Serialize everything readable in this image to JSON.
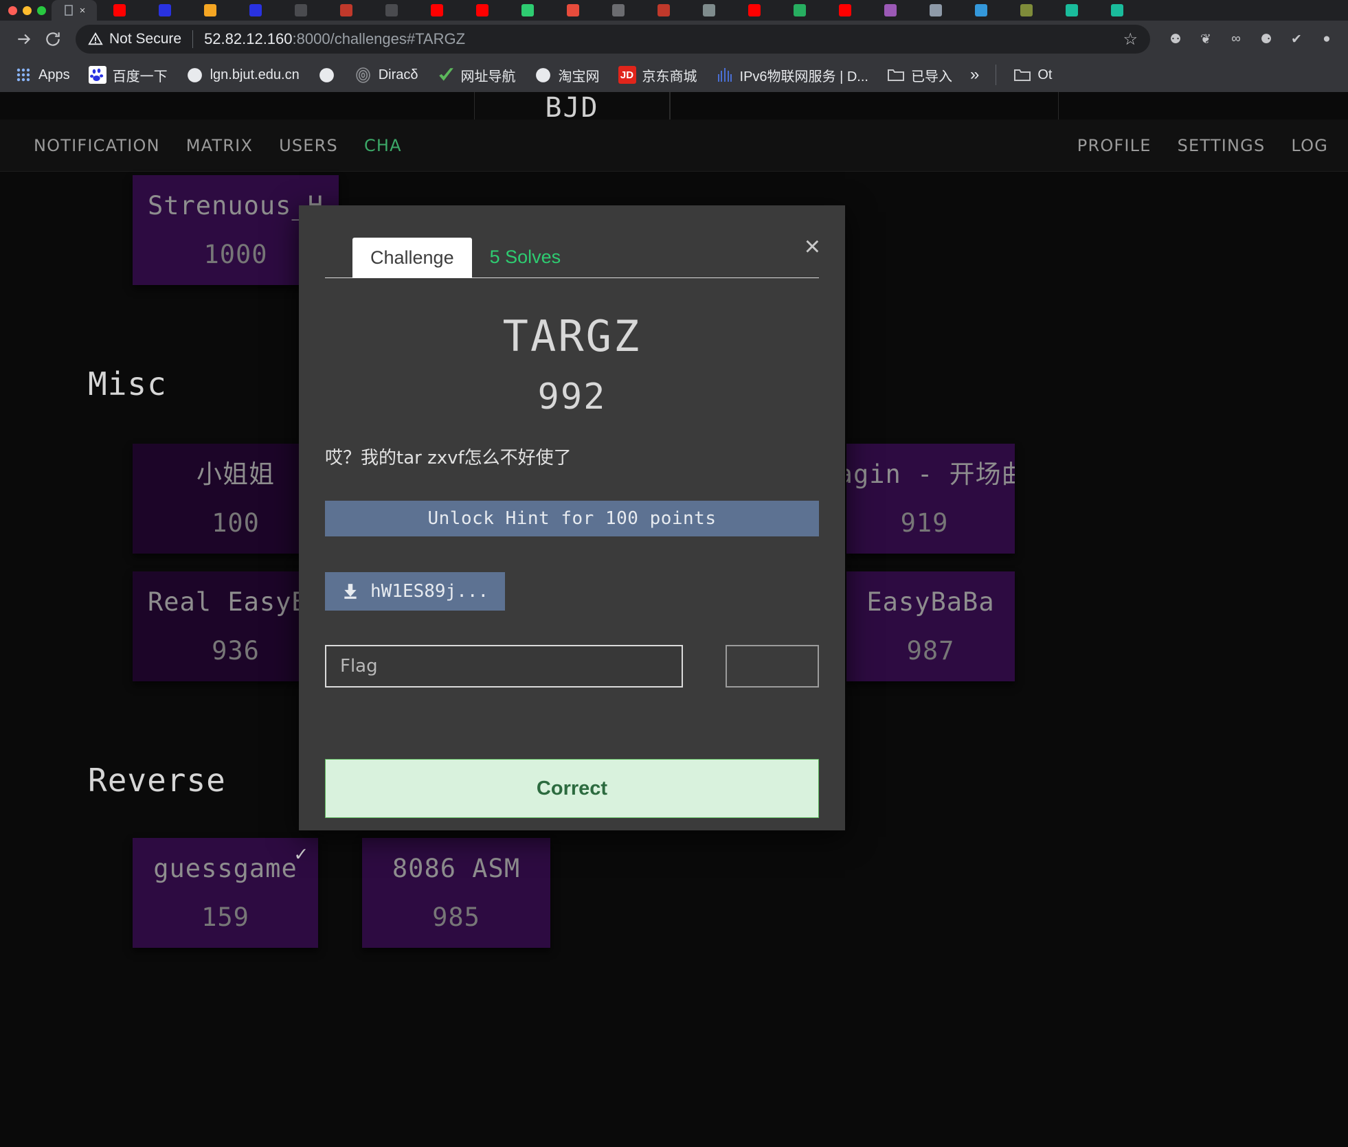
{
  "browser": {
    "window_dots": [
      "red",
      "yellow",
      "green"
    ],
    "tabs": [
      {
        "name": "active-tab",
        "favicon": "blank-page-icon",
        "color": "#5f6368",
        "label": "",
        "active": true
      },
      {
        "name": "tab-youtube",
        "favicon": "youtube-icon",
        "color": "#ff0000",
        "label": ""
      },
      {
        "name": "tab-baidu",
        "favicon": "baidu-icon",
        "color": "#2932e1",
        "label": ""
      },
      {
        "name": "tab-orange",
        "favicon": "orange-circle-icon",
        "color": "#f5a623",
        "label": ""
      },
      {
        "name": "tab-baidu-2",
        "favicon": "baidu-icon",
        "color": "#2932e1",
        "label": ""
      },
      {
        "name": "tab-grey",
        "favicon": "document-icon",
        "color": "#4a4b4f",
        "label": ""
      },
      {
        "name": "tab-red-doc",
        "favicon": "red-doc-icon",
        "color": "#c0392b",
        "label": ""
      },
      {
        "name": "tab-grey-2",
        "favicon": "document-icon",
        "color": "#4a4b4f",
        "label": ""
      },
      {
        "name": "tab-youtube-2",
        "favicon": "youtube-icon",
        "color": "#ff0000",
        "label": ""
      },
      {
        "name": "tab-youtube-3",
        "favicon": "youtube-icon",
        "color": "#ff0000",
        "label": ""
      },
      {
        "name": "tab-chrome",
        "favicon": "chrome-icon",
        "color": "#2ecc71",
        "label": ""
      },
      {
        "name": "tab-adobe",
        "favicon": "adobe-icon",
        "color": "#e74c3c",
        "label": ""
      },
      {
        "name": "tab-user",
        "favicon": "user-circle-icon",
        "color": "#6b6c70",
        "label": ""
      },
      {
        "name": "tab-zhihu",
        "favicon": "zhihu-icon",
        "color": "#c0392b",
        "label": ""
      },
      {
        "name": "tab-notes",
        "favicon": "notes-icon",
        "color": "#7f8c8d",
        "label": ""
      },
      {
        "name": "tab-youtube-4",
        "favicon": "youtube-icon",
        "color": "#ff0000",
        "label": ""
      },
      {
        "name": "tab-check",
        "favicon": "green-check-icon",
        "color": "#27ae60",
        "label": ""
      },
      {
        "name": "tab-youtube-5",
        "favicon": "youtube-icon",
        "color": "#ff0000",
        "label": ""
      },
      {
        "name": "tab-rainbow",
        "favicon": "rainbow-icon",
        "color": "#9b59b6",
        "label": ""
      },
      {
        "name": "tab-image",
        "favicon": "image-icon",
        "color": "#8e9aa8",
        "label": ""
      },
      {
        "name": "tab-blue",
        "favicon": "blue-icon",
        "color": "#3498db",
        "label": ""
      },
      {
        "name": "tab-olive",
        "favicon": "olive-icon",
        "color": "#7f8c3a",
        "label": ""
      },
      {
        "name": "tab-teal",
        "favicon": "teal-icon",
        "color": "#1abc9c",
        "label": ""
      },
      {
        "name": "tab-teal-2",
        "favicon": "teal-icon",
        "color": "#1abc9c",
        "label": ""
      }
    ],
    "toolbar": {
      "forward_icon": "forward-arrow-icon",
      "reload_icon": "reload-icon",
      "security_label": "Not Secure",
      "security_icon": "warning-triangle-icon",
      "url_host": "52.82.12.160",
      "url_path": ":8000/challenges#TARGZ",
      "bookmark_icon": "star-icon",
      "extensions": [
        {
          "name": "github-extension-icon",
          "glyph": "⚉"
        },
        {
          "name": "puzzle-extension-icon",
          "glyph": "❦"
        },
        {
          "name": "glasses-extension-icon",
          "glyph": "∞"
        },
        {
          "name": "bulb-extension-icon",
          "glyph": "⚈"
        },
        {
          "name": "shield-check-extension-icon",
          "glyph": "✔"
        },
        {
          "name": "profile-avatar-icon",
          "glyph": "●"
        }
      ]
    },
    "bookmarks": [
      {
        "name": "bookmark-apps",
        "label": "Apps",
        "icon": "apps-grid-icon",
        "color": "transparent"
      },
      {
        "name": "bookmark-baidu",
        "label": "百度一下",
        "icon": "baidu-paw-icon",
        "color": "#ffffff"
      },
      {
        "name": "bookmark-lgn-bjut",
        "label": "lgn.bjut.edu.cn",
        "icon": "globe-icon",
        "color": "transparent"
      },
      {
        "name": "bookmark-globe-only",
        "label": "",
        "icon": "globe-icon",
        "color": "transparent"
      },
      {
        "name": "bookmark-dirac",
        "label": "Diracδ",
        "icon": "fingerprint-icon",
        "color": "transparent"
      },
      {
        "name": "bookmark-hao123",
        "label": "网址导航",
        "icon": "green-check-icon",
        "color": "transparent"
      },
      {
        "name": "bookmark-taobao",
        "label": "淘宝网",
        "icon": "globe-icon",
        "color": "transparent"
      },
      {
        "name": "bookmark-jd",
        "label": "京东商城",
        "icon": "jd-icon",
        "color": "#e1251b"
      },
      {
        "name": "bookmark-ipv6",
        "label": "IPv6物联网服务 | D...",
        "icon": "ipv6-icon",
        "color": "transparent"
      },
      {
        "name": "bookmark-imported",
        "label": "已导入",
        "icon": "folder-icon",
        "color": "transparent"
      }
    ],
    "bookmark_overflow_icon": "»",
    "bookmark_other": {
      "name": "bookmark-other",
      "label": "Ot",
      "icon": "folder-icon"
    }
  },
  "site": {
    "brand": "BJD",
    "nav_left": [
      {
        "name": "nav-notification",
        "label": "NOTIFICATION",
        "active": false
      },
      {
        "name": "nav-matrix",
        "label": "MATRIX",
        "active": false
      },
      {
        "name": "nav-users",
        "label": "USERS",
        "active": false
      },
      {
        "name": "nav-challenges",
        "label": "CHA",
        "active": true
      }
    ],
    "nav_right": [
      {
        "name": "nav-profile",
        "label": "PROFILE",
        "active": false
      },
      {
        "name": "nav-settings",
        "label": "SETTINGS",
        "active": false
      },
      {
        "name": "nav-logout",
        "label": "LOG",
        "active": false
      }
    ],
    "sections": [
      {
        "name": "section-misc",
        "label": "Misc"
      },
      {
        "name": "section-reverse",
        "label": "Reverse"
      }
    ],
    "cards": [
      {
        "name": "card-strenuous",
        "title": "Strenuous_H",
        "points": "1000",
        "solved": false,
        "dim": false
      },
      {
        "name": "card-xiaojiejie",
        "title": "小姐姐",
        "points": "100",
        "solved": false,
        "dim": true
      },
      {
        "name": "card-imagin",
        "title": "magin - 开场曲",
        "points": "919",
        "solved": false,
        "dim": false
      },
      {
        "name": "card-real-easybaba",
        "title": "Real EasyBa",
        "points": "936",
        "solved": false,
        "dim": true
      },
      {
        "name": "card-easybaba",
        "title": "EasyBaBa",
        "points": "987",
        "solved": false,
        "dim": false
      },
      {
        "name": "card-guessgame",
        "title": "guessgame",
        "points": "159",
        "solved": true,
        "dim": false
      },
      {
        "name": "card-8086asm",
        "title": "8086 ASM",
        "points": "985",
        "solved": false,
        "dim": false
      }
    ]
  },
  "modal": {
    "tabs": [
      {
        "name": "modal-tab-challenge",
        "label": "Challenge",
        "active": true
      },
      {
        "name": "modal-tab-solves",
        "label": "5 Solves",
        "active": false
      }
    ],
    "close_icon": "×",
    "title": "TARGZ",
    "points": "992",
    "description": "哎？我的tar zxvf怎么不好使了",
    "hint_label": "Unlock Hint for 100 points",
    "file_label": "hW1ES89j...",
    "file_icon": "download-icon",
    "flag_placeholder": "Flag",
    "flag_value": "",
    "submit_label": "Correct",
    "accent_hint": "#5d7292",
    "accent_submit_bg": "#d9f2dd",
    "accent_submit_text": "#2c6b3f"
  }
}
